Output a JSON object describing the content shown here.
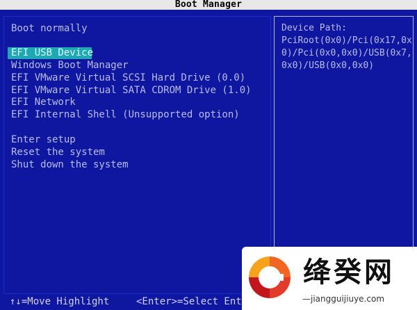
{
  "window": {
    "title": "Boot Manager"
  },
  "menu": {
    "items": [
      {
        "label": "Boot normally"
      },
      {
        "label": "EFI USB Device"
      },
      {
        "label": "Windows Boot Manager"
      },
      {
        "label": "EFI VMware Virtual SCSI Hard Drive (0.0)"
      },
      {
        "label": "EFI VMware Virtual SATA CDROM Drive (1.0)"
      },
      {
        "label": "EFI Network"
      },
      {
        "label": "EFI Internal Shell (Unsupported option)"
      },
      {
        "label": "Enter setup"
      },
      {
        "label": "Reset the system"
      },
      {
        "label": "Shut down the system"
      }
    ],
    "selected": "EFI USB Device"
  },
  "info_panel": {
    "lines": [
      "Device Path:",
      "PciRoot(0x0)/Pci(0x17,0x",
      "0)/Pci(0x0,0x0)/USB(0x7,",
      "0x0)/USB(0x0,0x0)"
    ]
  },
  "footer": {
    "move_hint": "↑↓=Move Highlight",
    "select_hint": "<Enter>=Select Entry"
  },
  "watermark": {
    "title": "绛癸网",
    "url": "—jiangguijiuye.com"
  },
  "colors": {
    "background": "#0f16a0",
    "highlight": "#1fa7b3",
    "text": "#b9bdea",
    "title_bar": "#e8e8e8"
  }
}
